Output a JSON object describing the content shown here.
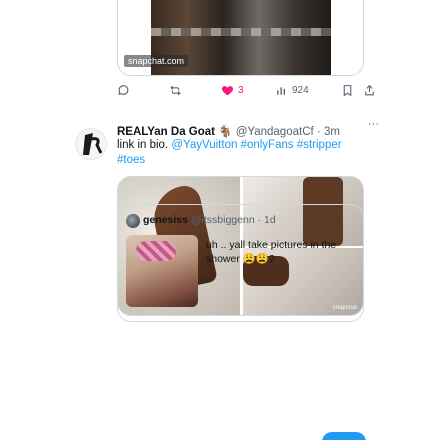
{
  "previous_tweet": {
    "media_badge": "snapchat.com",
    "actions": {
      "reply_count": "",
      "retweet_count": "",
      "like_count": "3",
      "views_count": "924",
      "like_active_color": "#f91880"
    }
  },
  "tweet": {
    "author_name": "REALYan Da Goat",
    "author_emoji": "🐐",
    "handle": "@YandagoatCf",
    "time": "3m",
    "more": "···",
    "text_plain": "link in bio.",
    "mention": "@YayVuitton",
    "hashtags": [
      "#onlyFans",
      "#stripper",
      "#toes"
    ],
    "media_watermark": "snapchat"
  },
  "quoted_tweet": {
    "author_name": "genesiss",
    "handle": "@itssbiggenn",
    "time": "1d",
    "text": "uh .. yall take pictures in the shower 😩😩?"
  },
  "colors": {
    "text_primary": "#0f1419",
    "text_secondary": "#536471",
    "link": "#1d9bf0",
    "border": "#cfd9de"
  }
}
